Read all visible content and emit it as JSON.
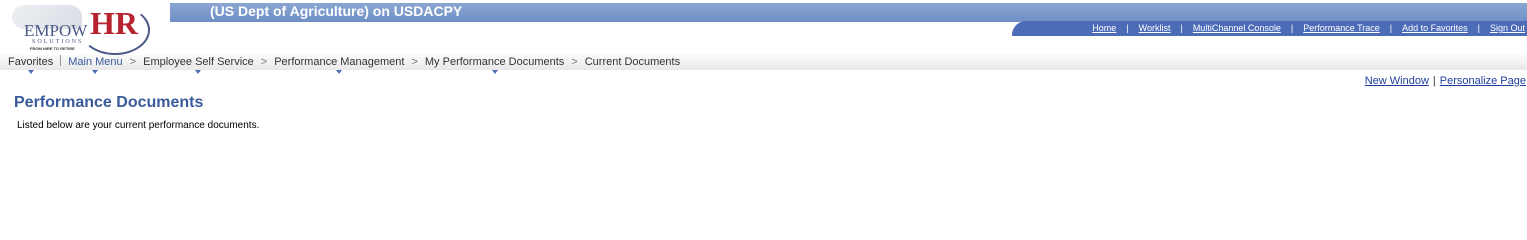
{
  "header": {
    "db_title": "(US Dept of Agriculture) on USDACPY",
    "logo": {
      "brand_a": "EMPOW",
      "brand_b": "HR",
      "sub": "SOLUTIONS",
      "tagline": "FROM HIRE TO RETIRE"
    },
    "nav_links": [
      {
        "label": "Home"
      },
      {
        "label": "Worklist"
      },
      {
        "label": "MultiChannel Console"
      },
      {
        "label": "Performance Trace"
      },
      {
        "label": "Add to Favorites"
      },
      {
        "label": "Sign Out"
      }
    ],
    "nav_separator": "|"
  },
  "breadcrumb": {
    "favorites": "Favorites",
    "main_menu": "Main Menu",
    "employee_self_service": "Employee Self Service",
    "performance_management": "Performance Management",
    "my_performance_documents": "My Performance Documents",
    "current_documents": "Current Documents",
    "arrow": ">"
  },
  "page_links": {
    "new_window": "New Window",
    "separator": "|",
    "personalize": "Personalize Page"
  },
  "main": {
    "title": "Performance Documents",
    "intro": "Listed below are your current performance documents."
  },
  "colors": {
    "header_band": "#7b98cb",
    "nav_bar": "#4d6cb8",
    "title": "#3a5a9c",
    "link": "#1f3f9f"
  }
}
